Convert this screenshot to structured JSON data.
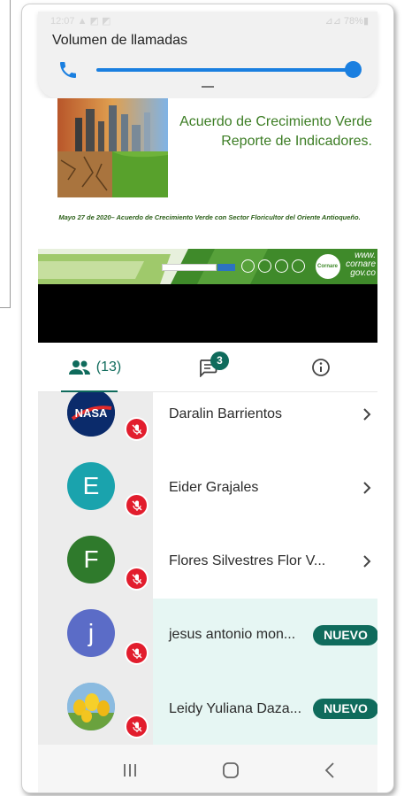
{
  "volume_panel": {
    "title": "Volumen de llamadas",
    "status_left": "12:07 ▲ ◩ ◩",
    "status_right": "⊿⊿ 78%▮",
    "level": 1.0,
    "accent_color": "#1a7fe0"
  },
  "slide": {
    "title_line1": "Acuerdo de Crecimiento Verde",
    "title_line2": "Reporte de Indicadores.",
    "caption": "Mayo 27 de 2020– Acuerdo de Crecimiento Verde con Sector Floricultor del Oriente Antioqueño.",
    "logo_text": "Cornare",
    "website": "www. cornare gov.co"
  },
  "tabs": {
    "participants_count": "(13)",
    "chat_badge": "3",
    "participants_icon": "people-icon",
    "chat_icon": "chat-icon",
    "info_icon": "info-icon",
    "accent_color": "#0f6b5c"
  },
  "participants": [
    {
      "name": "Daralin Barrientos",
      "avatar": "nasa-logo",
      "muted": true,
      "action": "chevron"
    },
    {
      "name": "Eider Grajales",
      "initial": "E",
      "avatar_color": "#1aa3ad",
      "muted": true,
      "action": "chevron"
    },
    {
      "name": "Flores Silvestres Flor V...",
      "initial": "F",
      "avatar_color": "#2f7a2c",
      "muted": true,
      "action": "chevron"
    },
    {
      "name": "jesus antonio mon...",
      "initial": "j",
      "avatar_color": "#5b6cc7",
      "muted": true,
      "badge": "NUEVO"
    },
    {
      "name": "Leidy Yuliana Daza...",
      "avatar": "tulips-photo",
      "muted": true,
      "badge": "NUEVO"
    }
  ],
  "nav": {
    "recents_icon": "recents-icon",
    "home_icon": "home-icon",
    "back_icon": "back-icon"
  }
}
